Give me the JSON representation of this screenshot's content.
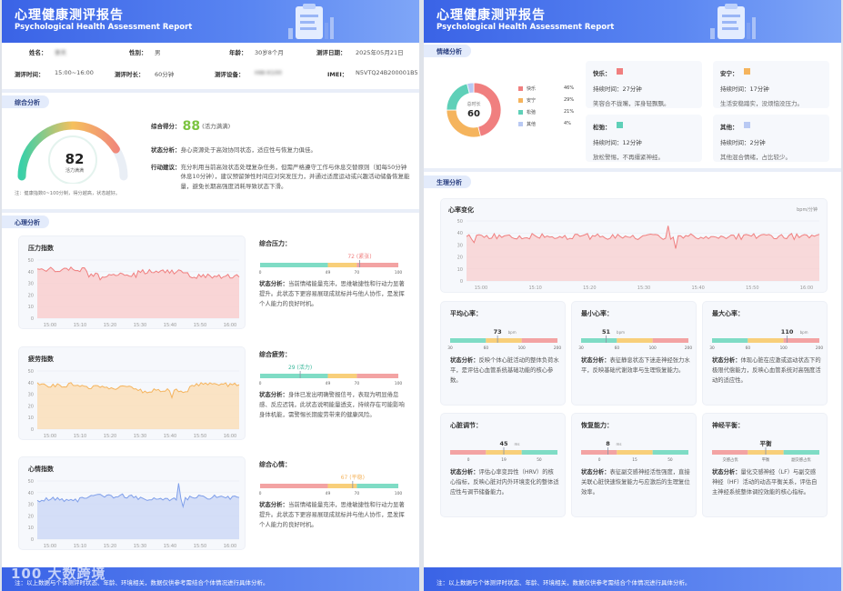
{
  "header": {
    "title_cn": "心理健康测评报告",
    "title_en": "Psychological Health Assessment Report"
  },
  "info": {
    "name_label": "姓名：",
    "name_value": "李天",
    "gender_label": "性别：",
    "gender_value": "男",
    "age_label": "年龄：",
    "age_value": "30岁8个月",
    "date_label": "测评日期：",
    "date_value": "2025年05月21日",
    "time_label": "测评时间：",
    "time_value": "15:00~16:00",
    "duration_label": "测评时长：",
    "duration_value": "60分钟",
    "device_label": "测评设备：",
    "device_value": "HW-X100",
    "imei_label": "IMEI：",
    "imei_value": "N5VTQ24B200001B5"
  },
  "summary": {
    "section": "综合分析",
    "score": "82",
    "score_caption": "活力满满",
    "score_fraction": 0.82,
    "note": "注：健康指数0~100分制，得分越高，状态越好。",
    "score_label": "综合得分：",
    "score_value": "88",
    "score_tag": "(活力满满)",
    "status_label": "状态分析：",
    "status_text": "身心资源处于高效协同状态，适应性与恢复力俱佳。",
    "advice_label": "行动建议：",
    "advice_text": "充分利用当前高效状态处理复杂任务，但需严格遵守工作与休息交替原则（如每50分钟休息10分钟），建议预留弹性时间应对突发压力，并通过适度运动或兴趣活动储备恢复能量，避免长期高强度消耗导致状态下滑。"
  },
  "psych": {
    "section": "心理分析",
    "charts": [
      {
        "title": "压力指数",
        "color": "#f07f7f",
        "fill": "#f9c9c9"
      },
      {
        "title": "疲劳指数",
        "color": "#f5b45d",
        "fill": "#fbdcb1"
      },
      {
        "title": "心情指数",
        "color": "#7f9fea",
        "fill": "#c8d6f6"
      }
    ],
    "y_ticks": [
      "50",
      "40",
      "30",
      "20",
      "10",
      "0"
    ],
    "x_ticks": [
      "15:00",
      "15:10",
      "15:20",
      "15:30",
      "15:40",
      "15:50",
      "16:00"
    ],
    "side": [
      {
        "title": "综合压力：",
        "value": "72",
        "tag": "(紧张)",
        "ticks": [
          "0",
          "49",
          "70",
          "100"
        ],
        "analysis_label": "状态分析：",
        "analysis": "当前情绪能量充沛，思维敏捷性和行动力显著提升。此状态下更容易展现成就标并与他人协作，是发挥个人能力的良好时机。"
      },
      {
        "title": "综合疲劳：",
        "value": "29",
        "tag": "(活力)",
        "ticks": [
          "0",
          "49",
          "70",
          "100"
        ],
        "analysis_label": "状态分析：",
        "analysis": "身体已发出明确警报信号，表现为明显倦怠感、反应迟钝，此状态说明能量透支，持续存在可能影响身体机能，需警惕长期疲劳带来的健康风险。"
      },
      {
        "title": "综合心情：",
        "value": "67",
        "tag": "(平稳)",
        "ticks": [
          "0",
          "49",
          "70",
          "100"
        ],
        "analysis_label": "状态分析：",
        "analysis": "当前情绪能量充沛，思维敏捷性和行动力显著提升。此状态下更容易展现成就标并与他人协作，是发挥个人能力的良好时机。"
      }
    ]
  },
  "footer": {
    "text": "注：以上数据与个体测评时状态、年龄、环境相关，数据仅供参考需结合个体情况进行具体分析。"
  },
  "emotion": {
    "section": "情绪分析",
    "center_label": "总时长",
    "center_value": "60",
    "legend": [
      {
        "name": "快乐",
        "pct": "46%",
        "color": "#f07f7f"
      },
      {
        "name": "安宁",
        "pct": "29%",
        "color": "#f5b45d"
      },
      {
        "name": "松弛",
        "pct": "21%",
        "color": "#5fd0b8"
      },
      {
        "name": "其他",
        "pct": "4%",
        "color": "#b9c9f3"
      }
    ],
    "cards": [
      {
        "name": "快乐：",
        "color": "#f07f7f",
        "dur": "持续时间：27分钟",
        "desc": "笑容合不拢嘴，浑身轻飘飘。"
      },
      {
        "name": "安宁：",
        "color": "#f5b45d",
        "dur": "持续时间：17分钟",
        "desc": "生活安稳踏实，没烦恼没压力。"
      },
      {
        "name": "松弛：",
        "color": "#5fd0b8",
        "dur": "持续时间：12分钟",
        "desc": "放松警惕，不再缰紧神经。"
      },
      {
        "name": "其他：",
        "color": "#b9c9f3",
        "dur": "持续时间：2分钟",
        "desc": "其他混合情绪，占比较少。"
      }
    ]
  },
  "physio": {
    "section": "生理分析",
    "hr_title": "心率变化",
    "hr_unit": "bpm/分钟",
    "metrics": [
      {
        "title": "平均心率：",
        "value": "73",
        "unit": "bpm",
        "ticks": [
          "30",
          "60",
          "100",
          "200"
        ],
        "analysis_label": "状态分析：",
        "analysis": "反映个体心脏活动的整体负荷水平，是评估心血管系统基础功能的核心参数。"
      },
      {
        "title": "最小心率：",
        "value": "51",
        "unit": "bpm",
        "ticks": [
          "30",
          "60",
          "100",
          "200"
        ],
        "analysis_label": "状态分析：",
        "analysis": "表征静息状态下迷走神经张力水平，反映基础代谢效率与生理恢复能力。"
      },
      {
        "title": "最大心率：",
        "value": "110",
        "unit": "bpm",
        "ticks": [
          "30",
          "60",
          "100",
          "200"
        ],
        "analysis_label": "状态分析：",
        "analysis": "体现心脏在应激或运动状态下的极限代偿能力，反映心血管系统对高强度活动的适应性。"
      },
      {
        "title": "心脏调节：",
        "value": "45",
        "unit": "ms",
        "ticks": [
          "0",
          "19",
          "50"
        ],
        "analysis_label": "状态分析：",
        "analysis": "评估心率变异性（HRV）的核心指标，反映心脏对内外环境变化的整体适应性与调节储备能力。"
      },
      {
        "title": "恢复能力：",
        "value": "8",
        "unit": "ms",
        "ticks": [
          "0",
          "15",
          "50"
        ],
        "analysis_label": "状态分析：",
        "analysis": "表征副交感神经活性强度，直接关联心脏快速恢复能力与应激后的生理复位效率。"
      },
      {
        "title": "神经平衡：",
        "value": "平衡",
        "unit": "",
        "ticks": [
          "交感占优",
          "平衡",
          "副交感占优"
        ],
        "analysis_label": "状态分析：",
        "analysis": "量化交感神经（LF）与副交感神经（HF）活动的动态平衡关系，评估自主神经系统整体调控效能的核心指标。"
      }
    ]
  },
  "watermark": "100 大数跨境"
}
